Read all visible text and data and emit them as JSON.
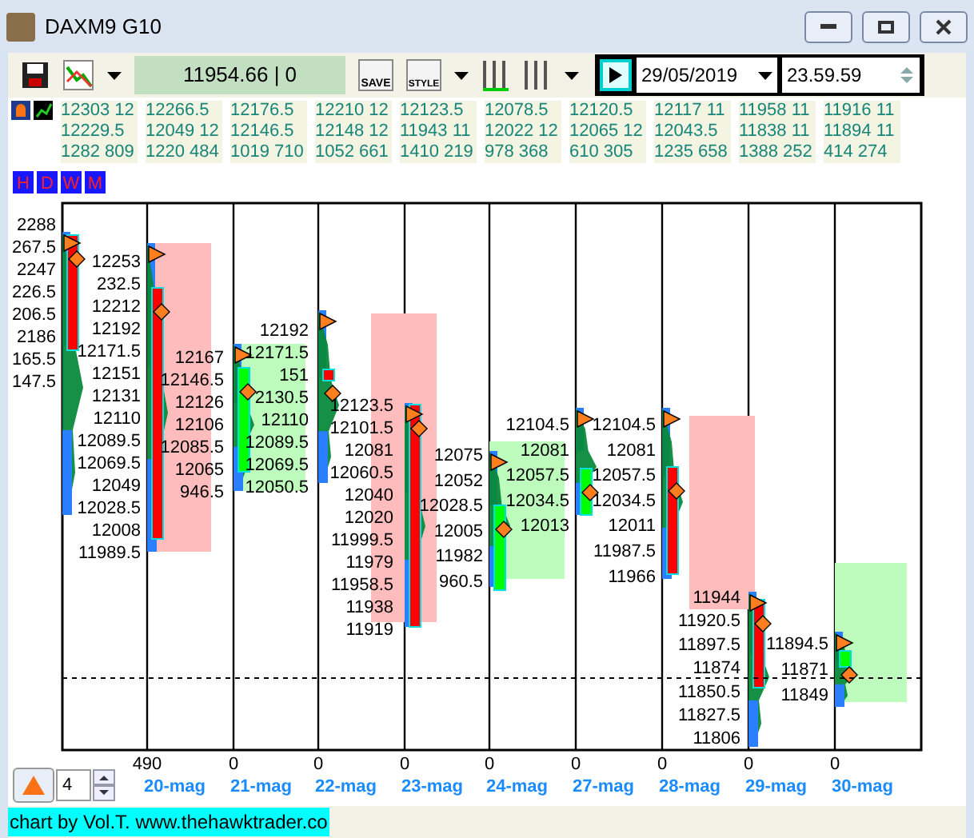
{
  "window": {
    "title": "DAXM9 G10"
  },
  "toolbar": {
    "price": "11954.66 | 0",
    "save_label": "SAVE",
    "style_label": "STYLE",
    "date": "29/05/2019",
    "time": "23.59.59"
  },
  "summary": [
    [
      "12303 12",
      "12229.5",
      "1282 809"
    ],
    [
      "12266.5",
      "12049 12",
      "1220 484"
    ],
    [
      "12176.5",
      "12146.5",
      "1019 710"
    ],
    [
      "12210 12",
      "12148 12",
      "1052 661"
    ],
    [
      "12123.5",
      "11943 11",
      "1410 219"
    ],
    [
      "12078.5",
      "12022 12",
      "978 368"
    ],
    [
      "12120.5",
      "12065 12",
      "610 305"
    ],
    [
      "12117 11",
      "12043.5",
      "1235 658"
    ],
    [
      "11958 11",
      "11838 11",
      "1388 252"
    ],
    [
      "11916 11",
      "11894 11",
      "414 274"
    ]
  ],
  "timeframes": [
    {
      "label": "H",
      "selected": false
    },
    {
      "label": "D",
      "selected": false
    },
    {
      "label": "W",
      "selected": false
    },
    {
      "label": "M",
      "selected": false
    }
  ],
  "sessions": [
    {
      "kind": "bearish",
      "value_area": false,
      "labels": [
        "2288",
        "267.5",
        "2247",
        "226.5",
        "206.5",
        "2186",
        "165.5",
        "147.5"
      ]
    },
    {
      "kind": "bearish",
      "value_area": true,
      "labels": [
        "12253",
        "232.5",
        "12212",
        "12192",
        "12171.5",
        "12151",
        "12131",
        "12110",
        "12089.5",
        "12069.5",
        "12049",
        "12028.5",
        "12008",
        "11989.5"
      ]
    },
    {
      "kind": "bullish",
      "value_area": true,
      "labels": [
        "12167",
        "12146.5",
        "12126",
        "12106",
        "12085.5",
        "12065",
        "946.5"
      ]
    },
    {
      "kind": "bearish",
      "value_area": false,
      "labels": [
        "12192",
        "12171.5",
        "151",
        "2130.5",
        "12110",
        "12089.5",
        "12069.5",
        "12050.5"
      ]
    },
    {
      "kind": "bearish",
      "value_area": true,
      "labels": [
        "12123.5",
        "12101.5",
        "12081",
        "12060.5",
        "12040",
        "12020",
        "11999.5",
        "11979",
        "11958.5",
        "11938",
        "11919"
      ]
    },
    {
      "kind": "bullish",
      "value_area": true,
      "labels": [
        "12075",
        "12052",
        "12028.5",
        "12005",
        "11982",
        "960.5"
      ]
    },
    {
      "kind": "bullish",
      "value_area": false,
      "labels": [
        "12104.5",
        "12081",
        "12057.5",
        "12034.5",
        "12013"
      ]
    },
    {
      "kind": "bearish",
      "value_area": true,
      "labels": [
        "12104.5",
        "12081",
        "12057.5",
        "12034.5",
        "12011",
        "11987.5",
        "11966"
      ]
    },
    {
      "kind": "bearish",
      "value_area": false,
      "labels": [
        "11944",
        "11920.5",
        "11897.5",
        "11874",
        "11850.5",
        "11827.5",
        "11806"
      ]
    },
    {
      "kind": "bullish",
      "value_area": true,
      "labels": [
        "11894.5",
        "11871",
        "11849"
      ]
    }
  ],
  "x_axis": [
    {
      "value": "490",
      "date": "20-mag"
    },
    {
      "value": "0",
      "date": "21-mag"
    },
    {
      "value": "0",
      "date": "22-mag"
    },
    {
      "value": "0",
      "date": "23-mag"
    },
    {
      "value": "0",
      "date": "24-mag"
    },
    {
      "value": "0",
      "date": "27-mag"
    },
    {
      "value": "0",
      "date": "28-mag"
    },
    {
      "value": "0",
      "date": "29-mag"
    },
    {
      "value": "0",
      "date": "30-mag"
    }
  ],
  "bar_count": "4",
  "status_bar": "chart by Vol.T. www.thehawktrader.co"
}
